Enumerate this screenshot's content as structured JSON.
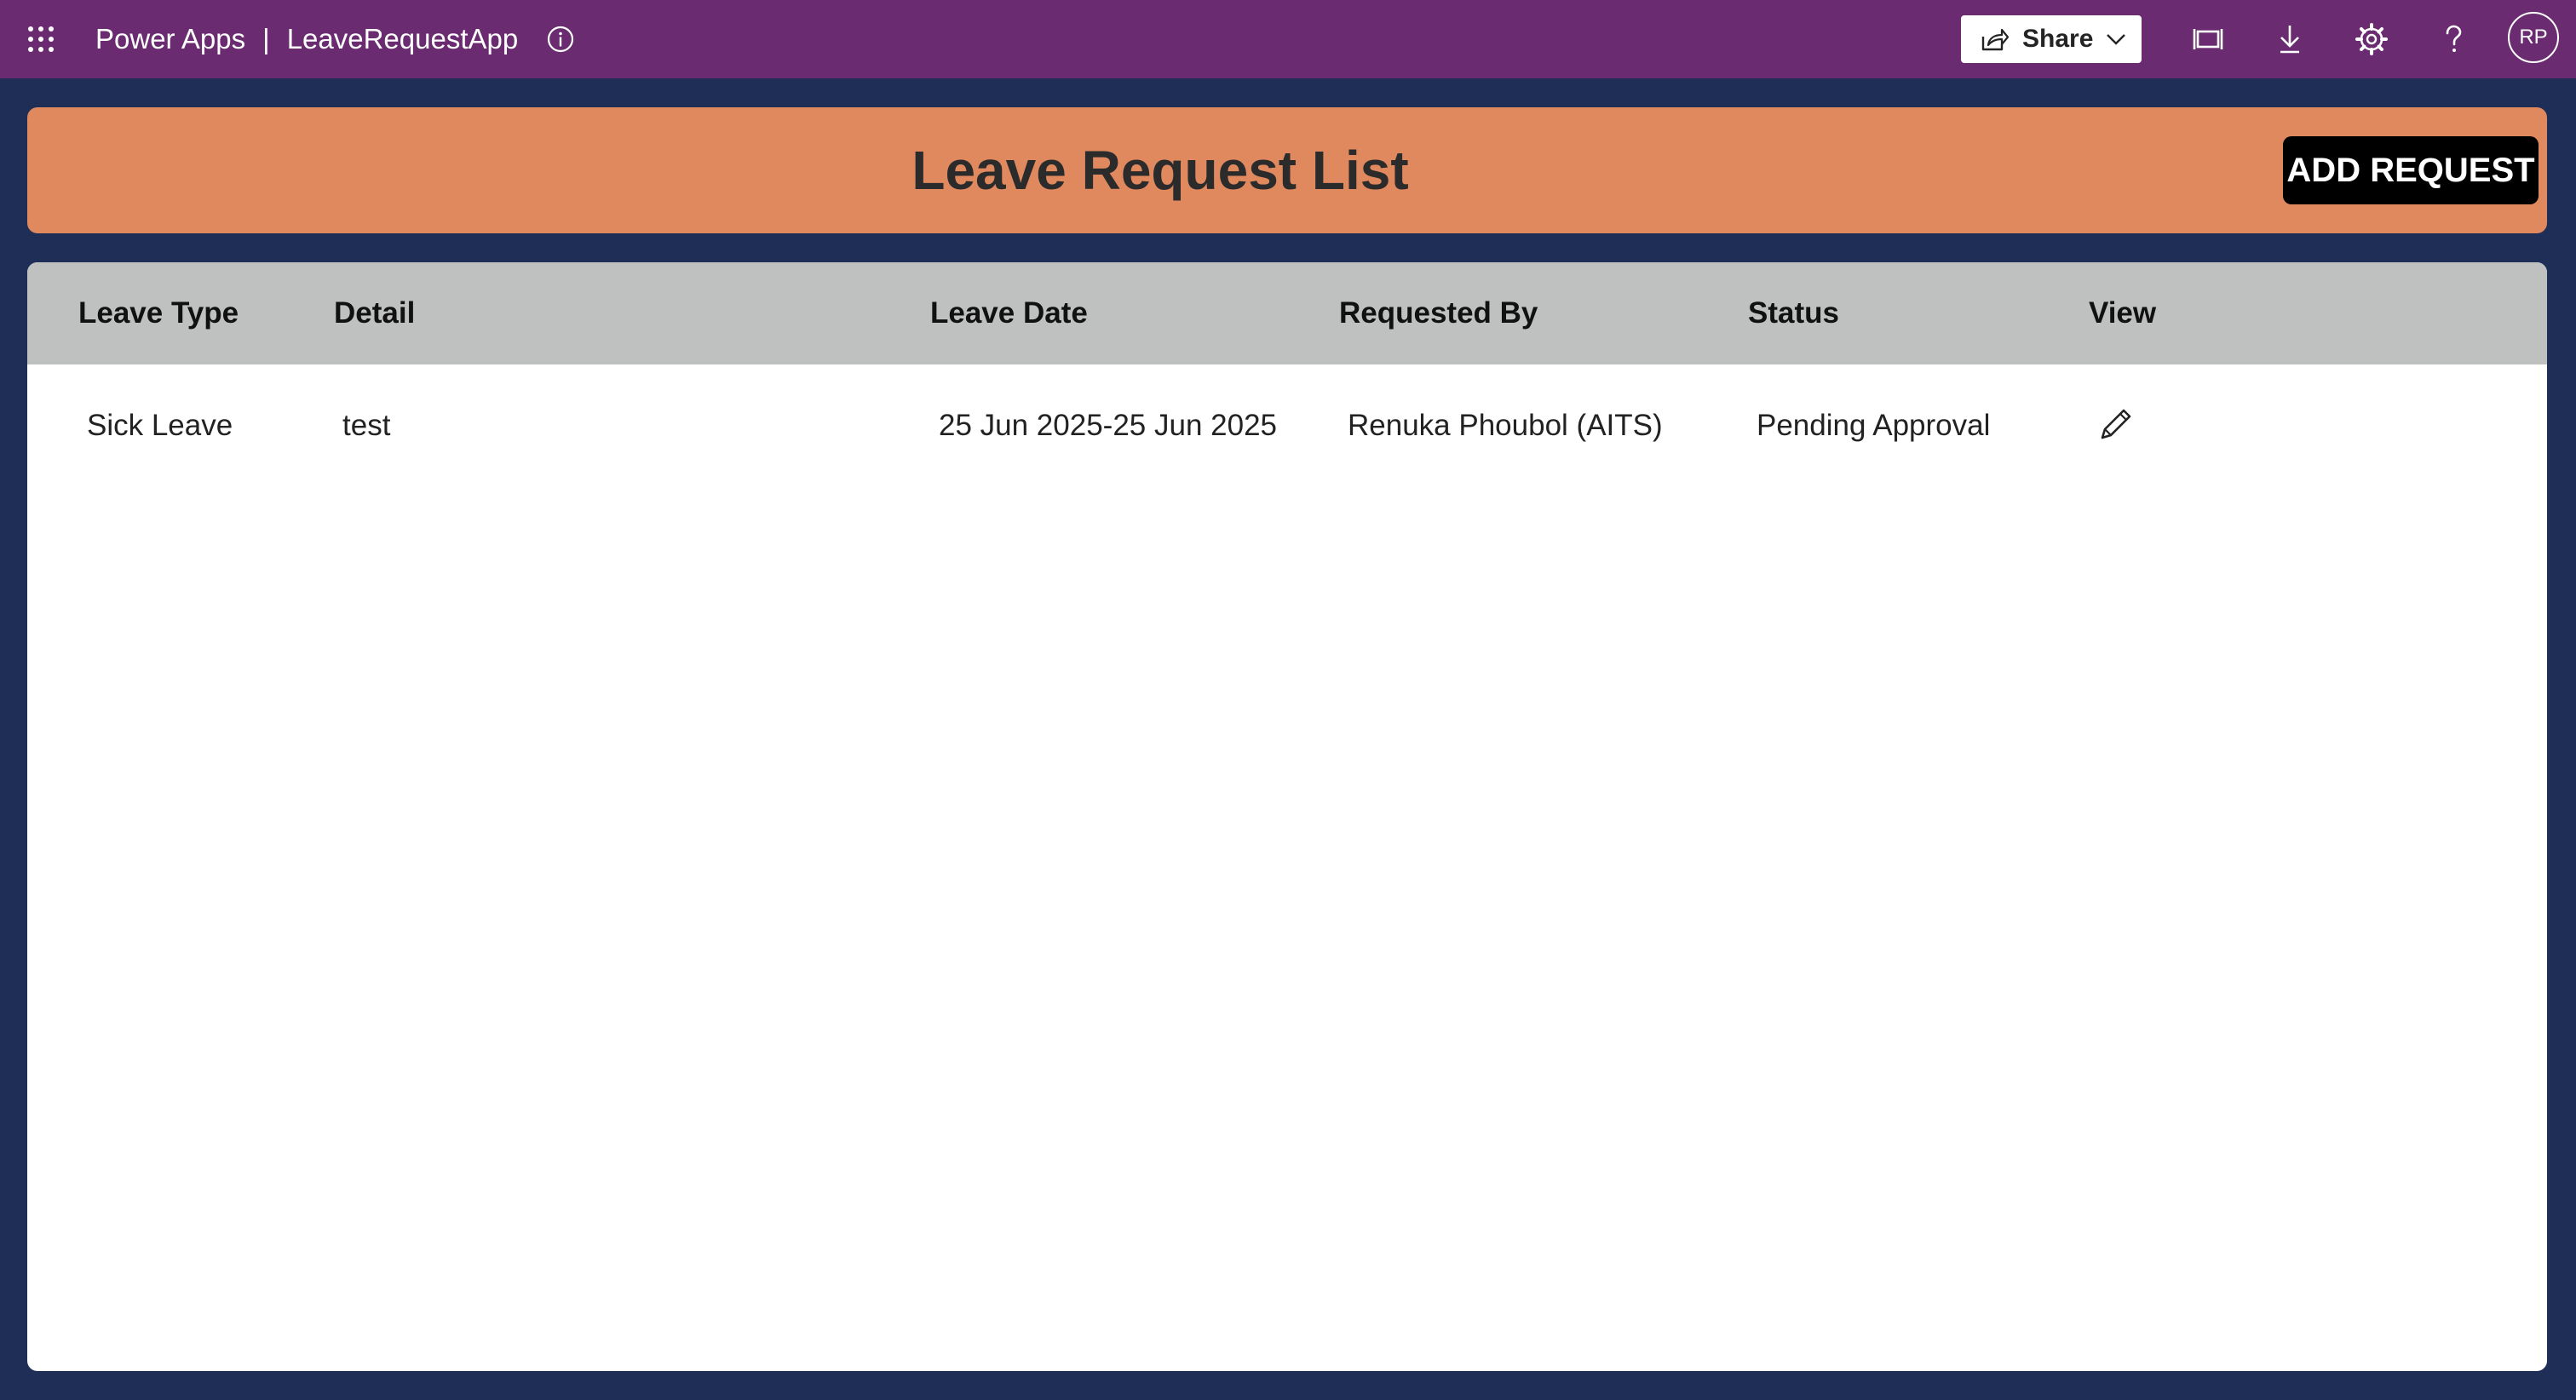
{
  "topbar": {
    "product": "Power Apps",
    "separator": "|",
    "app_name": "LeaveRequestApp",
    "share_label": "Share",
    "avatar_initials": "RP",
    "icons": [
      "waffle-icon",
      "info-icon",
      "share-icon",
      "chevron-down-icon",
      "fit-screen-icon",
      "download-icon",
      "gear-icon",
      "help-icon"
    ]
  },
  "header": {
    "title": "Leave Request List",
    "add_button_label": "ADD REQUEST"
  },
  "table": {
    "columns": [
      "Leave Type",
      "Detail",
      "Leave Date",
      "Requested By",
      "Status",
      "View"
    ],
    "rows": [
      {
        "leave_type": "Sick Leave",
        "detail": "test",
        "leave_date": "25 Jun 2025-25 Jun 2025",
        "requested_by": "Renuka Phoubol (AITS)",
        "status": "Pending Approval",
        "view_icon": "edit-icon"
      }
    ]
  },
  "colors": {
    "topbar": "#6b2b70",
    "background": "#1f2e57",
    "header_band": "#e0895f",
    "table_header": "#bfc1c1",
    "add_button": "#000000"
  }
}
